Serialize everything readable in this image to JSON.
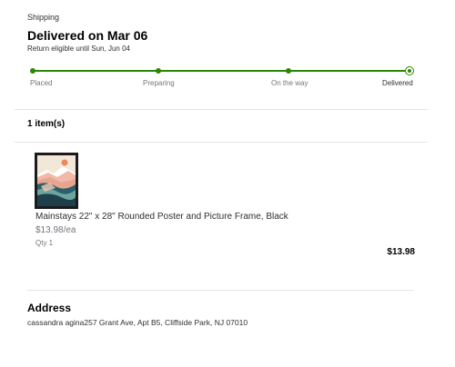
{
  "shipping": {
    "label": "Shipping",
    "status": "Delivered on Mar 06",
    "return_note": "Return eligible until Sun, Jun 04"
  },
  "tracker": {
    "color": "#2a8703",
    "steps": [
      {
        "label": "Placed",
        "completed": true
      },
      {
        "label": "Preparing",
        "completed": true
      },
      {
        "label": "On the way",
        "completed": true
      },
      {
        "label": "Delivered",
        "completed": true,
        "current": true
      }
    ]
  },
  "items": {
    "count_label": "1 item(s)",
    "list": [
      {
        "name": "Mainstays 22\" x 28\" Rounded Poster and Picture Frame, Black",
        "unit_price": "$13.98/ea",
        "quantity": "Qty 1",
        "total": "$13.98",
        "image": "framed-abstract-landscape-poster"
      }
    ]
  },
  "address": {
    "title": "Address",
    "text": "cassandra agina257 Grant Ave, Apt B5, Cliffside Park, NJ 07010"
  }
}
